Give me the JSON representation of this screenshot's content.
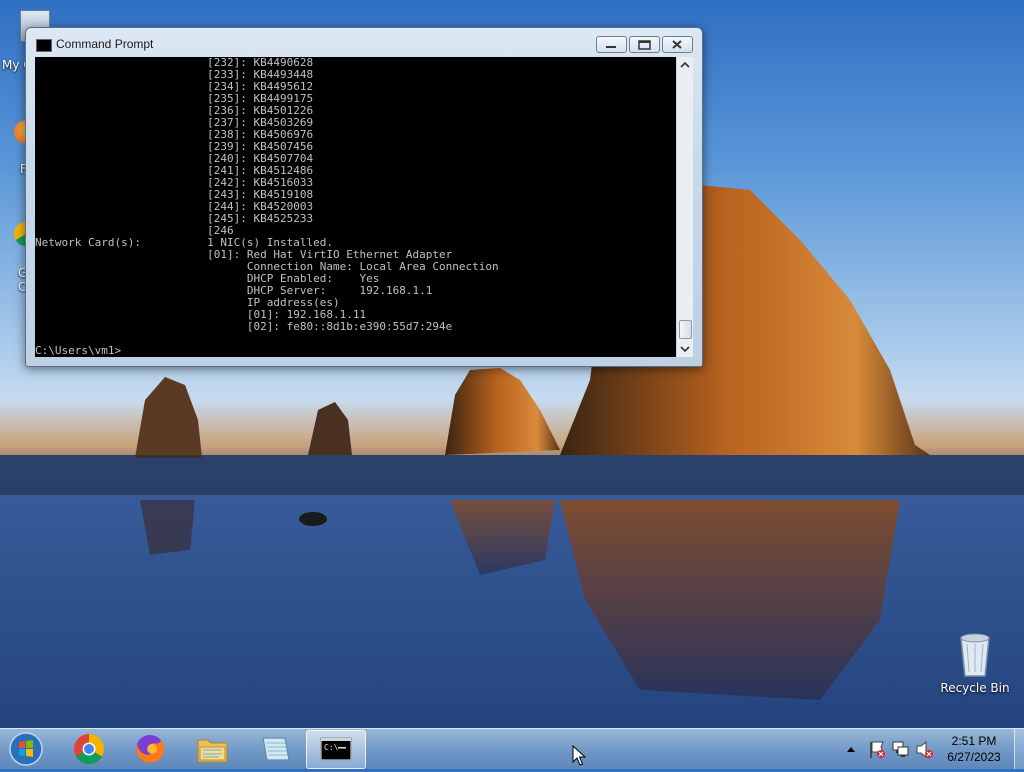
{
  "desktop": {
    "partial_icon_labels": [
      "My C",
      "F",
      "G",
      "C"
    ],
    "recycle_bin_label": "Recycle Bin"
  },
  "window": {
    "title": "Command Prompt",
    "console_lines": [
      "                          [232]: KB4490628",
      "                          [233]: KB4493448",
      "                          [234]: KB4495612",
      "                          [235]: KB4499175",
      "                          [236]: KB4501226",
      "                          [237]: KB4503269",
      "                          [238]: KB4506976",
      "                          [239]: KB4507456",
      "                          [240]: KB4507704",
      "                          [241]: KB4512486",
      "                          [242]: KB4516033",
      "                          [243]: KB4519108",
      "                          [244]: KB4520003",
      "                          [245]: KB4525233",
      "                          [246",
      "Network Card(s):          1 NIC(s) Installed.",
      "                          [01]: Red Hat VirtIO Ethernet Adapter",
      "                                Connection Name: Local Area Connection",
      "                                DHCP Enabled:    Yes",
      "                                DHCP Server:     192.168.1.1",
      "                                IP address(es)",
      "                                [01]: 192.168.1.11",
      "                                [02]: fe80::8d1b:e390:55d7:294e"
    ],
    "prompt": "C:\\Users\\vm1>"
  },
  "taskbar": {
    "pinned": [
      "Start",
      "Google Chrome",
      "Firefox",
      "Windows Explorer",
      "Notepad",
      "Command Prompt"
    ],
    "clock_time": "2:51 PM",
    "clock_date": "6/27/2023"
  }
}
